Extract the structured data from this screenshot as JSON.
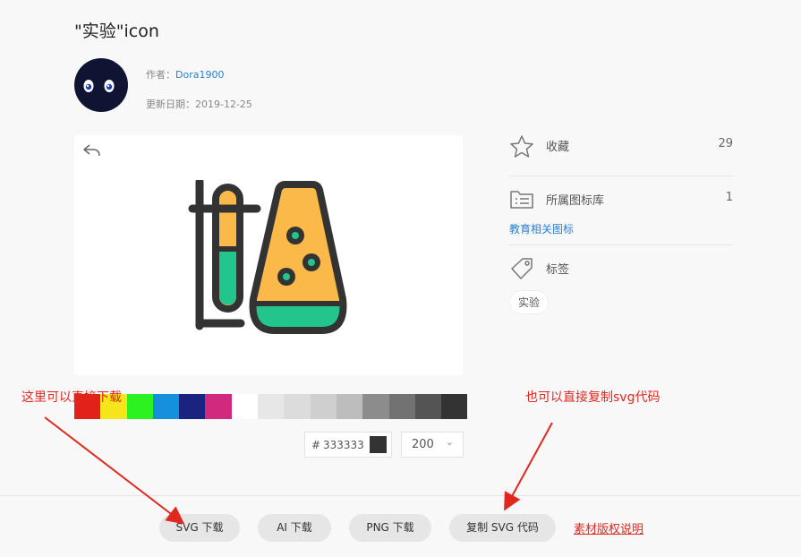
{
  "page": {
    "title": "\"实验\"icon"
  },
  "author": {
    "label": "作者：",
    "name": "Dora1900",
    "date_label": "更新日期：",
    "date": "2019-12-25"
  },
  "sidebar": {
    "favorites": {
      "label": "收藏",
      "count": "29"
    },
    "library": {
      "label": "所属图标库",
      "count": "1",
      "link": "教育相关图标"
    },
    "tags": {
      "label": "标签",
      "items": [
        "实验"
      ]
    }
  },
  "palette": {
    "colors": [
      "#e3211b",
      "#f5e51b",
      "#2cf221",
      "#1591db",
      "#1b2380",
      "#d02a7e",
      "#ffffff",
      "#e7e7e7",
      "#dcdcdc",
      "#cfcfcf",
      "#bdbdbd",
      "#8c8c8c",
      "#727272",
      "#545454",
      "#333333"
    ]
  },
  "color_input": {
    "hash": "#",
    "value": "333333",
    "swatch_color": "#333333"
  },
  "size_select": {
    "value": "200"
  },
  "actions": {
    "svg_download": "SVG 下载",
    "ai_download": "AI 下载",
    "png_download": "PNG 下载",
    "copy_svg": "复制 SVG 代码",
    "license": "素材版权说明"
  },
  "annotations": {
    "left": "这里可以直接下载",
    "right": "也可以直接复制svg代码"
  },
  "icon_colors": {
    "stroke": "#333333",
    "orange": "#fbb94a",
    "green": "#22c68c"
  }
}
